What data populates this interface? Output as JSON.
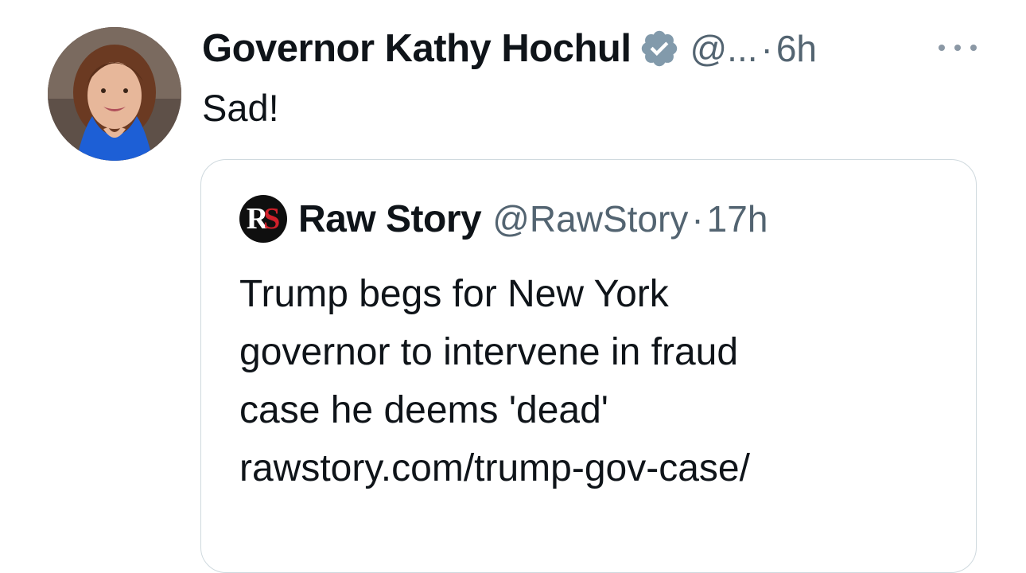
{
  "tweet": {
    "author": {
      "display_name": "Governor Kathy Hochul",
      "handle": "@...",
      "verified": true,
      "avatar_icon": "profile-photo"
    },
    "separator": "·",
    "time": "6h",
    "text": "Sad!",
    "more_icon": "ellipsis-icon"
  },
  "quote": {
    "author": {
      "display_name": "Raw Story",
      "handle": "@RawStory",
      "logo_text": "RS"
    },
    "separator": "·",
    "time": "17h",
    "lines": [
      "Trump begs for New York",
      "governor to intervene in fraud",
      "case he deems 'dead'",
      "rawstory.com/trump-gov-case/"
    ]
  },
  "colors": {
    "text_primary": "#0f1419",
    "text_secondary": "#536471",
    "border": "#cfd9de",
    "verified_badge": "#829aab",
    "logo_red": "#d0202a"
  }
}
